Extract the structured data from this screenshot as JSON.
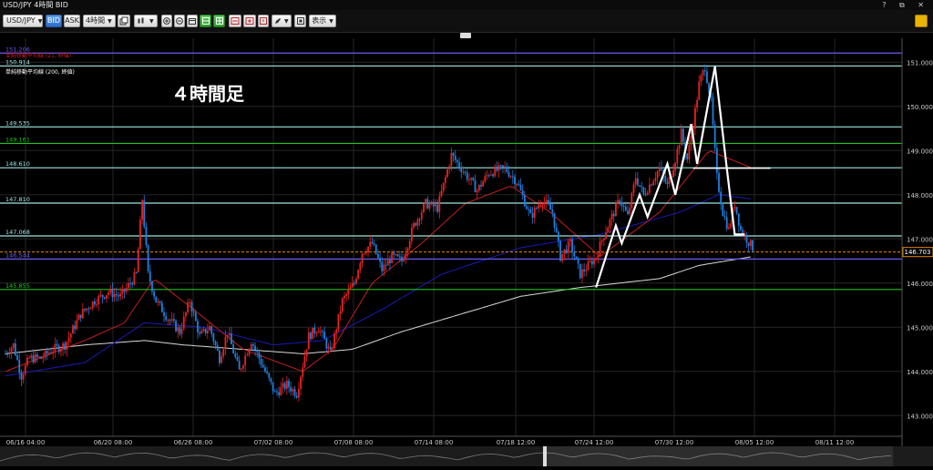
{
  "window": {
    "title": "USD/JPY 4時間 BID",
    "controls": "? ⧉ ✕"
  },
  "toolbar": {
    "symbol": "USD/JPY",
    "bid_label": "BID",
    "ask_label": "ASK",
    "timeframe": "4時間",
    "display_label": "表示"
  },
  "colors": {
    "background": "#000000",
    "candle_up": "#e8231f",
    "candle_down": "#1f7fe0",
    "ma_short": "#c41f1f",
    "ma_mid": "#1a1ab8",
    "ma_long": "#d8d8d8",
    "level_cyan": "#9fe6e0",
    "level_green": "#1ec21e",
    "level_purple": "#6a5af0",
    "current_price": "#e68a00",
    "annotation": "#ffffff"
  },
  "chart_data": {
    "type": "candlestick",
    "title": "４時間足",
    "ylim": [
      142.8,
      151.5
    ],
    "y_ticks": [
      "151.000",
      "150.000",
      "149.000",
      "148.000",
      "147.000",
      "146.000",
      "145.000",
      "144.000",
      "143.000"
    ],
    "x_ticks": [
      "06/16 04:00",
      "06/20 08:00",
      "06/26 08:00",
      "07/02 08:00",
      "07/08 08:00",
      "07/14 08:00",
      "07/18 12:00",
      "07/24 12:00",
      "07/30 12:00",
      "08/05 12:00",
      "08/11 12:00"
    ],
    "legend": [
      {
        "name": "単純移動平均線 (21, 終値)",
        "color": "#c41f1f"
      },
      {
        "name": "単純移動平均線 (200, 終値)",
        "color": "#ffffff"
      }
    ],
    "current_price": 146.703,
    "current_price_label": "146.703",
    "levels": [
      {
        "value": 151.206,
        "label": "151.206",
        "color": "#6a5af0"
      },
      {
        "value": 150.914,
        "label": "150.914",
        "color": "#9fe6e0"
      },
      {
        "value": 149.535,
        "label": "149.535",
        "color": "#9fe6e0"
      },
      {
        "value": 149.161,
        "label": "149.161",
        "color": "#1ec21e"
      },
      {
        "value": 148.61,
        "label": "148.610",
        "color": "#9fe6e0"
      },
      {
        "value": 147.81,
        "label": "147.810",
        "color": "#9fe6e0"
      },
      {
        "value": 147.068,
        "label": "147.068",
        "color": "#9fe6e0"
      },
      {
        "value": 146.544,
        "label": "146.544",
        "color": "#6a5af0"
      },
      {
        "value": 145.855,
        "label": "145.855",
        "color": "#1ec21e"
      }
    ],
    "ohlc_anchors": [
      [
        0,
        144.4
      ],
      [
        4,
        144.6
      ],
      [
        8,
        143.9
      ],
      [
        12,
        144.3
      ],
      [
        18,
        144.3
      ],
      [
        24,
        144.5
      ],
      [
        30,
        144.6
      ],
      [
        38,
        145.3
      ],
      [
        45,
        145.6
      ],
      [
        52,
        145.8
      ],
      [
        58,
        145.7
      ],
      [
        63,
        146.0
      ],
      [
        66,
        146.2
      ],
      [
        69,
        147.9
      ],
      [
        72,
        146.2
      ],
      [
        76,
        145.6
      ],
      [
        82,
        145.2
      ],
      [
        88,
        144.9
      ],
      [
        93,
        145.6
      ],
      [
        98,
        144.8
      ],
      [
        103,
        145.0
      ],
      [
        108,
        144.3
      ],
      [
        112,
        144.9
      ],
      [
        118,
        144.0
      ],
      [
        124,
        144.7
      ],
      [
        130,
        144.1
      ],
      [
        136,
        143.5
      ],
      [
        142,
        143.7
      ],
      [
        147,
        143.5
      ],
      [
        153,
        144.8
      ],
      [
        158,
        145.0
      ],
      [
        164,
        144.4
      ],
      [
        170,
        145.6
      ],
      [
        176,
        146.0
      ],
      [
        180,
        146.7
      ],
      [
        185,
        146.9
      ],
      [
        190,
        146.3
      ],
      [
        195,
        146.6
      ],
      [
        200,
        146.5
      ],
      [
        206,
        147.3
      ],
      [
        212,
        147.8
      ],
      [
        218,
        147.7
      ],
      [
        225,
        148.9
      ],
      [
        230,
        148.6
      ],
      [
        238,
        148.1
      ],
      [
        244,
        148.5
      ],
      [
        252,
        148.6
      ],
      [
        258,
        148.3
      ],
      [
        265,
        147.5
      ],
      [
        271,
        147.9
      ],
      [
        276,
        147.6
      ],
      [
        280,
        146.6
      ],
      [
        285,
        146.9
      ],
      [
        290,
        146.2
      ],
      [
        294,
        146.4
      ],
      [
        298,
        146.6
      ],
      [
        302,
        147.1
      ],
      [
        306,
        147.5
      ],
      [
        310,
        147.9
      ],
      [
        314,
        147.5
      ],
      [
        318,
        148.4
      ],
      [
        322,
        148.0
      ],
      [
        326,
        148.3
      ],
      [
        330,
        148.6
      ],
      [
        334,
        148.2
      ],
      [
        338,
        148.8
      ],
      [
        341,
        149.4
      ],
      [
        344,
        148.8
      ],
      [
        347,
        149.6
      ],
      [
        350,
        150.5
      ],
      [
        353,
        150.9
      ],
      [
        356,
        150.1
      ],
      [
        359,
        148.4
      ],
      [
        362,
        147.6
      ],
      [
        365,
        147.2
      ],
      [
        368,
        147.8
      ],
      [
        371,
        147.2
      ],
      [
        374,
        147.0
      ],
      [
        377,
        146.8
      ]
    ],
    "ma21_anchors": [
      [
        0,
        144.0
      ],
      [
        40,
        144.7
      ],
      [
        60,
        145.1
      ],
      [
        75,
        146.1
      ],
      [
        95,
        145.4
      ],
      [
        120,
        144.5
      ],
      [
        150,
        144.0
      ],
      [
        165,
        144.5
      ],
      [
        185,
        146.0
      ],
      [
        210,
        146.9
      ],
      [
        232,
        147.8
      ],
      [
        255,
        148.2
      ],
      [
        275,
        147.6
      ],
      [
        300,
        146.6
      ],
      [
        330,
        147.6
      ],
      [
        355,
        149.0
      ],
      [
        377,
        148.6
      ]
    ],
    "ma_mid_anchors": [
      [
        0,
        143.9
      ],
      [
        40,
        144.2
      ],
      [
        70,
        145.1
      ],
      [
        100,
        145.0
      ],
      [
        135,
        144.6
      ],
      [
        160,
        144.7
      ],
      [
        190,
        145.4
      ],
      [
        220,
        146.2
      ],
      [
        260,
        146.8
      ],
      [
        300,
        147.1
      ],
      [
        340,
        147.6
      ],
      [
        360,
        148.0
      ],
      [
        377,
        147.9
      ]
    ],
    "ma200_anchors": [
      [
        0,
        144.4
      ],
      [
        40,
        144.6
      ],
      [
        70,
        144.7
      ],
      [
        90,
        144.6
      ],
      [
        120,
        144.5
      ],
      [
        150,
        144.4
      ],
      [
        175,
        144.5
      ],
      [
        200,
        144.9
      ],
      [
        230,
        145.3
      ],
      [
        260,
        145.7
      ],
      [
        290,
        145.9
      ],
      [
        310,
        146.0
      ],
      [
        330,
        146.1
      ],
      [
        350,
        146.4
      ],
      [
        377,
        146.6
      ]
    ],
    "zigzag": [
      [
        298,
        145.9
      ],
      [
        308,
        147.3
      ],
      [
        311,
        146.9
      ],
      [
        320,
        148.0
      ],
      [
        324,
        147.5
      ],
      [
        334,
        148.7
      ],
      [
        338,
        148.0
      ],
      [
        346,
        149.6
      ],
      [
        349,
        148.7
      ],
      [
        358,
        150.9
      ],
      [
        364,
        148.6
      ],
      [
        368,
        147.1
      ],
      [
        373,
        147.1
      ]
    ],
    "neckline": [
      [
        347,
        148.6
      ],
      [
        386,
        148.6
      ]
    ]
  }
}
